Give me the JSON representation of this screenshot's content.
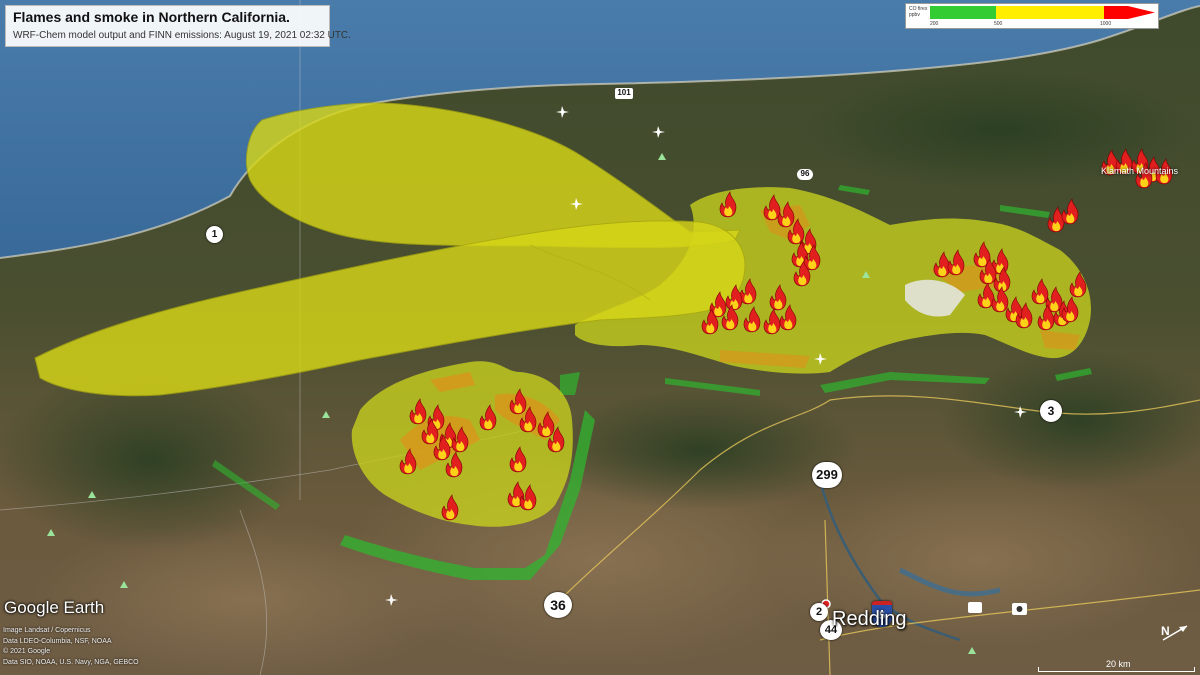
{
  "title": "Flames and smoke in Northern California.",
  "subtitle": "WRF-Chem model output and FINN emissions: August 19, 2021 02:32 UTC.",
  "legend": {
    "label_line1": "CO fires",
    "label_line2": "ppbv",
    "ticks": [
      "200",
      "500",
      "1000"
    ],
    "colors": [
      "#33cc33",
      "#ffee00",
      "#ff0000"
    ]
  },
  "brand": "Google Earth",
  "credits": [
    "Image Landsat / Copernicus",
    "Data LDEO-Columbia, NSF, NOAA",
    "© 2021 Google",
    "Data SIO, NOAA, U.S. Navy, NGA, GEBCO"
  ],
  "places": {
    "city": "Redding",
    "mountains": "Klamath Mountains"
  },
  "routes": {
    "r101": "101",
    "r96": "96",
    "r1": "1",
    "r3": "3",
    "r299": "299",
    "r36": "36",
    "r2": "2",
    "r44": "44",
    "r5": "5"
  },
  "scale": "20 km",
  "north": "N",
  "colors": {
    "ocean": "#2b5d8c",
    "plume": "#d6d618",
    "fire": "#e8301e",
    "burn_area": "#c8d21e"
  }
}
